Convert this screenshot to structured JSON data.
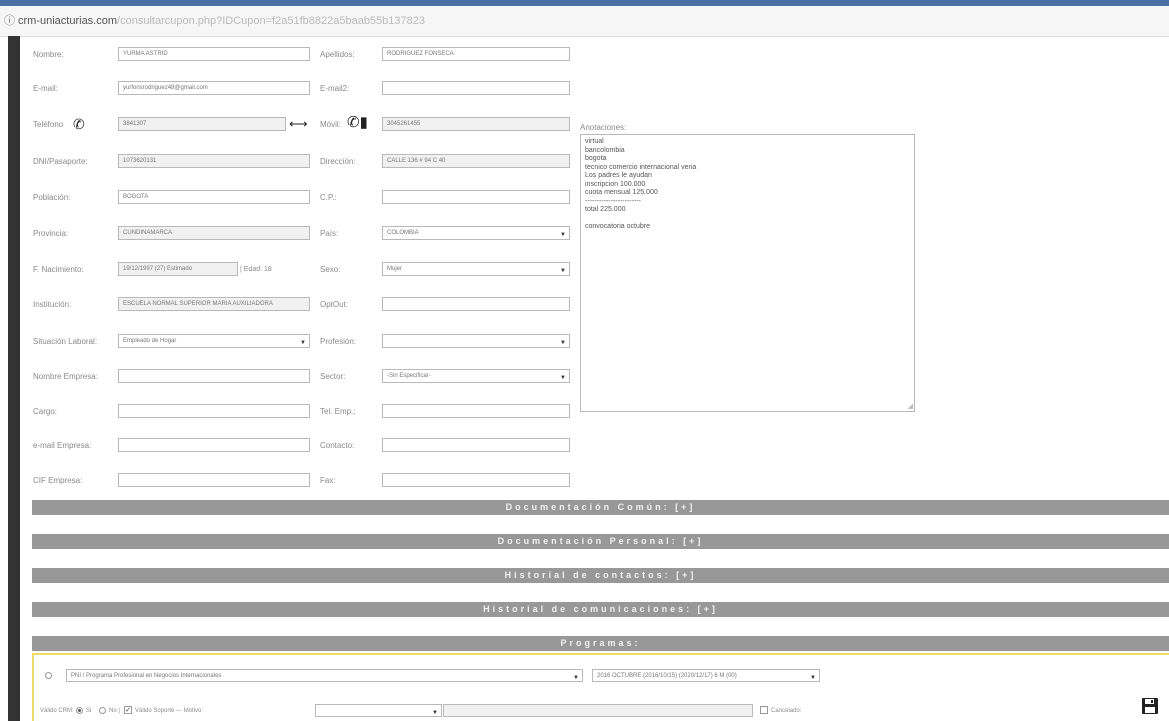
{
  "browser": {
    "info_icon": "info-circle-icon",
    "url_domain": "crm-uniacturias.com",
    "url_path": "/consultarcupon.php?IDCupon=f2a51fb8822a5baab55b137823"
  },
  "form": {
    "nombre": {
      "label": "Nombre:",
      "value": "YURMA ASTRID"
    },
    "apellidos": {
      "label": "Apellidos:",
      "value": "RODRIGUEZ FONSECA"
    },
    "email": {
      "label": "E-mail:",
      "value": "yurfonsrodriguez48@gmail.com"
    },
    "email2": {
      "label": "E-mail2:",
      "value": ""
    },
    "telefono": {
      "label": "Teléfono",
      "value": "3841307"
    },
    "movil": {
      "label": "Móvil:",
      "value": "3045261455"
    },
    "dni": {
      "label": "DNI/Pasaporte:",
      "value": "1073620131"
    },
    "direccion": {
      "label": "Dirección:",
      "value": "CALLE 136 # 94 C 40"
    },
    "poblacion": {
      "label": "Población:",
      "value": "BOGOTA"
    },
    "cp": {
      "label": "C.P.:",
      "value": ""
    },
    "provincia": {
      "label": "Provincia:",
      "value": "CUNDINAMARCA"
    },
    "pais": {
      "label": "País:",
      "value": "COLOMBIA"
    },
    "nacimiento": {
      "label": "F. Nacimiento:",
      "value": "19/12/1997 (27) Estimado",
      "edad": "| Edad: 18"
    },
    "sexo": {
      "label": "Sexo:",
      "value": "Mujer"
    },
    "institucion": {
      "label": "Institución:",
      "value": "ESCUELA NORMAL SUPERIOR MARIA AUXILIADORA"
    },
    "optout": {
      "label": "OptOut:",
      "value": ""
    },
    "situacion": {
      "label": "Situación Laboral:",
      "value": "Empleado de Hogar"
    },
    "profesion": {
      "label": "Profesión:",
      "value": ""
    },
    "empresa": {
      "label": "Nombre Empresa:",
      "value": ""
    },
    "sector": {
      "label": "Sector:",
      "value": "-Sin Especificar-"
    },
    "cargo": {
      "label": "Cargo:",
      "value": ""
    },
    "tel_empresa": {
      "label": "Tel. Emp.:",
      "value": ""
    },
    "email_empresa": {
      "label": "e-mail Empresa:",
      "value": ""
    },
    "contacto": {
      "label": "Contacto:",
      "value": ""
    },
    "cif": {
      "label": "CIF Empresa:",
      "value": ""
    },
    "fax": {
      "label": "Fax:",
      "value": ""
    }
  },
  "observaciones": {
    "label": "Anotaciones:",
    "lines": [
      "virtual",
      "bancolombia",
      "bogota",
      "tecnico comercio internacional vena",
      "Los padres le ayudan",
      "inscripcion 100.000",
      "cuota mensual 125.000",
      "------------------------",
      "total 225.000",
      "",
      "convocatoria octubre"
    ]
  },
  "sections": [
    "Documentación Común: [+]",
    "Documentación Personal: [+]",
    "Historial de contactos: [+]",
    "Historial de comunicaciones: [+]",
    "Programas:"
  ],
  "programas": {
    "programa": "PNI / Programa Profesional en Negocios Internacionales",
    "convocatoria": "2016 OCTUBRE (2016/10/15) (2020/12/17) 6 M (00)",
    "valido_crm_label": "Válido CRM:",
    "si": "Si",
    "no": "No |",
    "valido_soporte": "Válido Soporte --- Motivo:",
    "motivo": "",
    "cancelado": "Cancelado:",
    "save_icon": "floppy-disk-icon"
  },
  "icons": {
    "phone": "phone-icon",
    "swap": "swap-arrows-icon",
    "mobile": "mobile-phone-icon"
  }
}
